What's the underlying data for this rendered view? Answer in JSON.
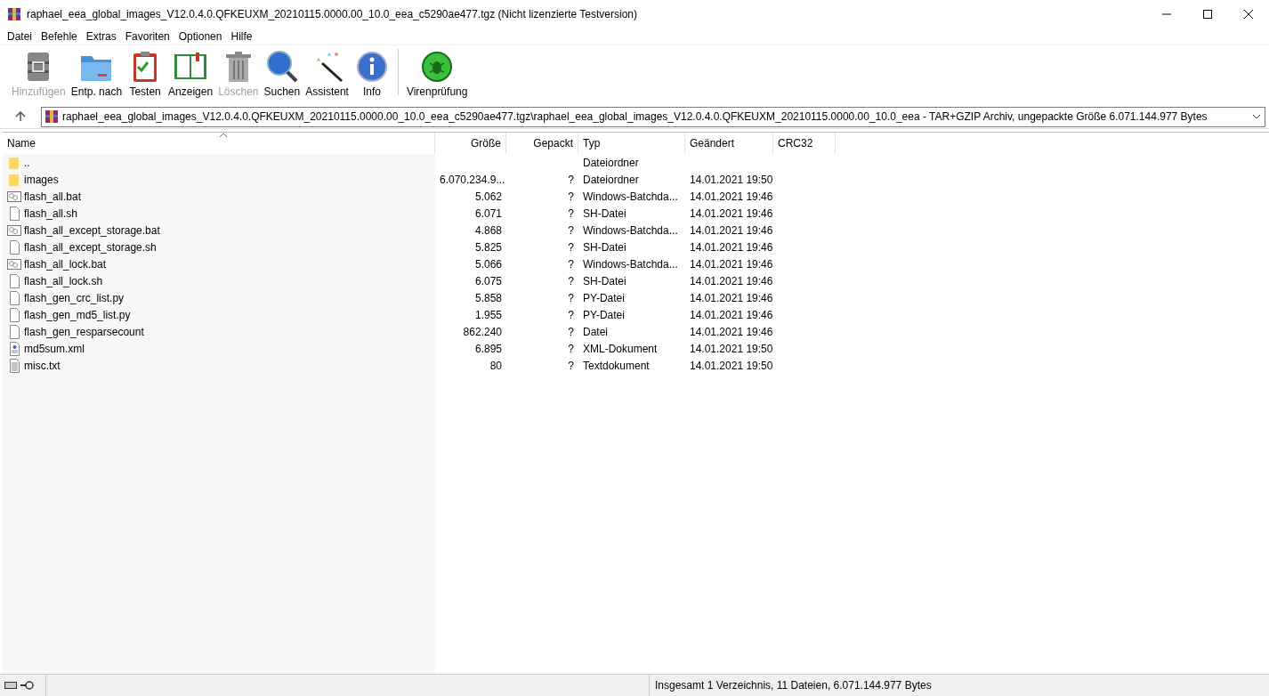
{
  "window": {
    "title": "raphael_eea_global_images_V12.0.4.0.QFKEUXM_20210115.0000.00_10.0_eea_c5290ae477.tgz (Nicht lizenzierte Testversion)"
  },
  "menu": [
    "Datei",
    "Befehle",
    "Extras",
    "Favoriten",
    "Optionen",
    "Hilfe"
  ],
  "toolbar": [
    {
      "label": "Hinzufügen",
      "kind": "add",
      "disabled": true
    },
    {
      "label": "Entp. nach",
      "kind": "extract",
      "disabled": false
    },
    {
      "label": "Testen",
      "kind": "test",
      "disabled": false
    },
    {
      "label": "Anzeigen",
      "kind": "view",
      "disabled": false
    },
    {
      "label": "Löschen",
      "kind": "delete",
      "disabled": true
    },
    {
      "label": "Suchen",
      "kind": "find",
      "disabled": false
    },
    {
      "label": "Assistent",
      "kind": "wizard",
      "disabled": false
    },
    {
      "label": "Info",
      "kind": "info",
      "disabled": false
    },
    {
      "label": "Virenprüfung",
      "kind": "virus",
      "disabled": false
    }
  ],
  "address": "raphael_eea_global_images_V12.0.4.0.QFKEUXM_20210115.0000.00_10.0_eea_c5290ae477.tgz\\raphael_eea_global_images_V12.0.4.0.QFKEUXM_20210115.0000.00_10.0_eea - TAR+GZIP Archiv, ungepackte Größe 6.071.144.977 Bytes",
  "table": {
    "columns": [
      {
        "label": "Name",
        "sorted": true
      },
      {
        "label": "Größe",
        "sorted": false
      },
      {
        "label": "Gepackt",
        "sorted": false
      },
      {
        "label": "Typ",
        "sorted": false
      },
      {
        "label": "Geändert",
        "sorted": false
      },
      {
        "label": "CRC32",
        "sorted": false
      }
    ],
    "rows": [
      {
        "kind": "folder",
        "name": "..",
        "size": "",
        "packed": "",
        "type": "Dateiordner",
        "modified": ""
      },
      {
        "kind": "folder",
        "name": "images",
        "size": "6.070.234.9...",
        "packed": "?",
        "type": "Dateiordner",
        "modified": "14.01.2021 19:50"
      },
      {
        "kind": "bat",
        "name": "flash_all.bat",
        "size": "5.062",
        "packed": "?",
        "type": "Windows-Batchda...",
        "modified": "14.01.2021 19:46"
      },
      {
        "kind": "file",
        "name": "flash_all.sh",
        "size": "6.071",
        "packed": "?",
        "type": "SH-Datei",
        "modified": "14.01.2021 19:46"
      },
      {
        "kind": "bat",
        "name": "flash_all_except_storage.bat",
        "size": "4.868",
        "packed": "?",
        "type": "Windows-Batchda...",
        "modified": "14.01.2021 19:46"
      },
      {
        "kind": "file",
        "name": "flash_all_except_storage.sh",
        "size": "5.825",
        "packed": "?",
        "type": "SH-Datei",
        "modified": "14.01.2021 19:46"
      },
      {
        "kind": "bat",
        "name": "flash_all_lock.bat",
        "size": "5.066",
        "packed": "?",
        "type": "Windows-Batchda...",
        "modified": "14.01.2021 19:46"
      },
      {
        "kind": "file",
        "name": "flash_all_lock.sh",
        "size": "6.075",
        "packed": "?",
        "type": "SH-Datei",
        "modified": "14.01.2021 19:46"
      },
      {
        "kind": "file",
        "name": "flash_gen_crc_list.py",
        "size": "5.858",
        "packed": "?",
        "type": "PY-Datei",
        "modified": "14.01.2021 19:46"
      },
      {
        "kind": "file",
        "name": "flash_gen_md5_list.py",
        "size": "1.955",
        "packed": "?",
        "type": "PY-Datei",
        "modified": "14.01.2021 19:46"
      },
      {
        "kind": "file",
        "name": "flash_gen_resparsecount",
        "size": "862.240",
        "packed": "?",
        "type": "Datei",
        "modified": "14.01.2021 19:46"
      },
      {
        "kind": "xml",
        "name": "md5sum.xml",
        "size": "6.895",
        "packed": "?",
        "type": "XML-Dokument",
        "modified": "14.01.2021 19:50"
      },
      {
        "kind": "txt",
        "name": "misc.txt",
        "size": "80",
        "packed": "?",
        "type": "Textdokument",
        "modified": "14.01.2021 19:50"
      }
    ]
  },
  "status_bar": "Insgesamt 1 Verzeichnis, 11 Dateien, 6.071.144.977 Bytes"
}
